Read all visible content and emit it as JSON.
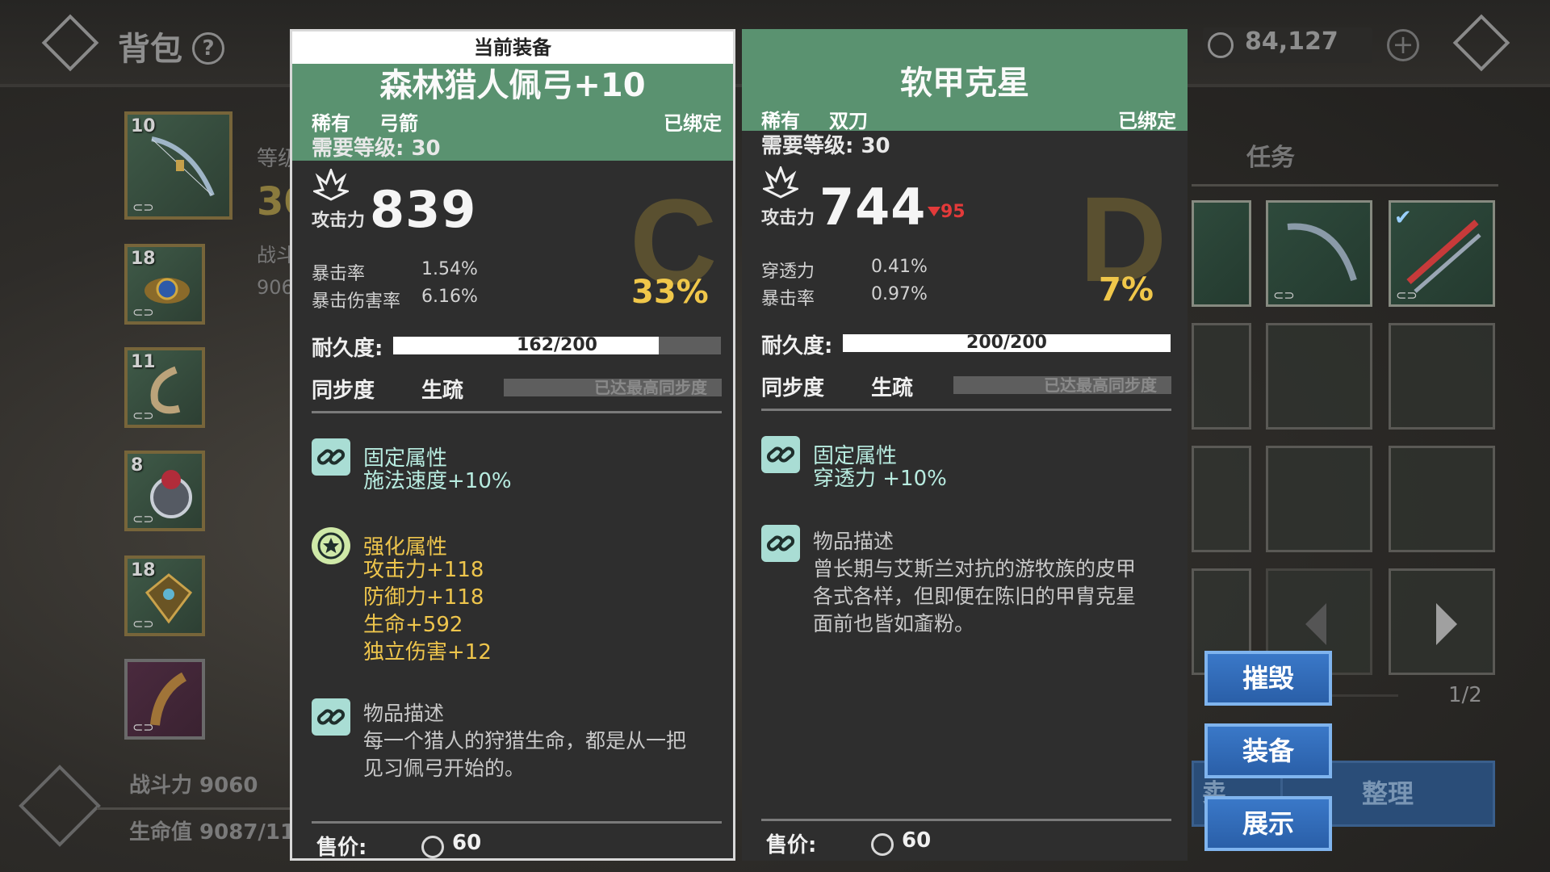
{
  "header": {
    "title": "背包",
    "currency_value": "84,127"
  },
  "left_panel": {
    "slots": [
      {
        "level": "10",
        "icon": "bow-icon"
      },
      {
        "level": "18",
        "icon": "amulet-icon"
      },
      {
        "level": "11",
        "icon": "bracelet-icon"
      },
      {
        "level": "8",
        "icon": "ring-icon"
      },
      {
        "level": "18",
        "icon": "crest-icon"
      },
      {
        "level": "",
        "icon": "horn-icon"
      }
    ],
    "partial_label_level": "等级",
    "partial_level_value": "30",
    "partial_label_power": "战斗",
    "partial_power_value": "906",
    "combat_power": "战斗力 9060",
    "hp": "生命值 9087/11"
  },
  "right_panel": {
    "task_label": "任务",
    "page": "1/2",
    "sell_partial": "卖",
    "sort_button": "整理"
  },
  "actions": {
    "destroy": "摧毁",
    "equip": "装备",
    "show": "展示"
  },
  "current_item": {
    "tag": "当前装备",
    "name": "森林猎人佩弓+10",
    "rarity": "稀有",
    "type": "弓箭",
    "bound": "已绑定",
    "required_level": "需要等级:  30",
    "attack_label": "攻击力",
    "attack_value": "839",
    "grade": "C",
    "grade_percent": "33%",
    "stats": [
      {
        "name": "暴击率",
        "value": "1.54%"
      },
      {
        "name": "暴击伤害率",
        "value": "6.16%"
      }
    ],
    "durability_label": "耐久度:",
    "durability_text": "162/200",
    "durability_fraction": 0.81,
    "sync_label": "同步度",
    "sync_state": "生疏",
    "sync_bar_text": "已达最高同步度",
    "fixed_attr_title": "固定属性",
    "fixed_attr_lines": [
      "施法速度+10%"
    ],
    "enhance_title": "强化属性",
    "enhance_lines": [
      "攻击力+118",
      "防御力+118",
      "生命+592",
      "独立伤害+12"
    ],
    "desc_title": "物品描述",
    "desc_lines": [
      "每一个猎人的狩猎生命，都是从一把",
      "见习佩弓开始的。"
    ],
    "price_label": "售价:",
    "price_value": "60"
  },
  "compare_item": {
    "name": "软甲克星",
    "rarity": "稀有",
    "type": "双刀",
    "bound": "已绑定",
    "required_level": "需要等级:  30",
    "attack_label": "攻击力",
    "attack_value": "744",
    "attack_diff": "95",
    "grade": "D",
    "grade_percent": "7%",
    "stats": [
      {
        "name": "穿透力",
        "value": "0.41%"
      },
      {
        "name": "暴击率",
        "value": "0.97%"
      }
    ],
    "durability_label": "耐久度:",
    "durability_text": "200/200",
    "durability_fraction": 1.0,
    "sync_label": "同步度",
    "sync_state": "生疏",
    "sync_bar_text": "已达最高同步度",
    "fixed_attr_title": "固定属性",
    "fixed_attr_lines": [
      "穿透力 +10%"
    ],
    "desc_title": "物品描述",
    "desc_lines": [
      "曾长期与艾斯兰对抗的游牧族的皮甲",
      "各式各样，但即便在陈旧的甲胄克星",
      "面前也皆如齑粉。"
    ],
    "price_label": "售价:",
    "price_value": "60"
  },
  "colors": {
    "header_green": "#5a9270",
    "grade_percent": "#f0c74a",
    "fixed_attr": "#b8ece0",
    "enhance_attr": "#eec54c",
    "button_blue": "#3a78c8",
    "attack_down": "#e33a3a"
  }
}
